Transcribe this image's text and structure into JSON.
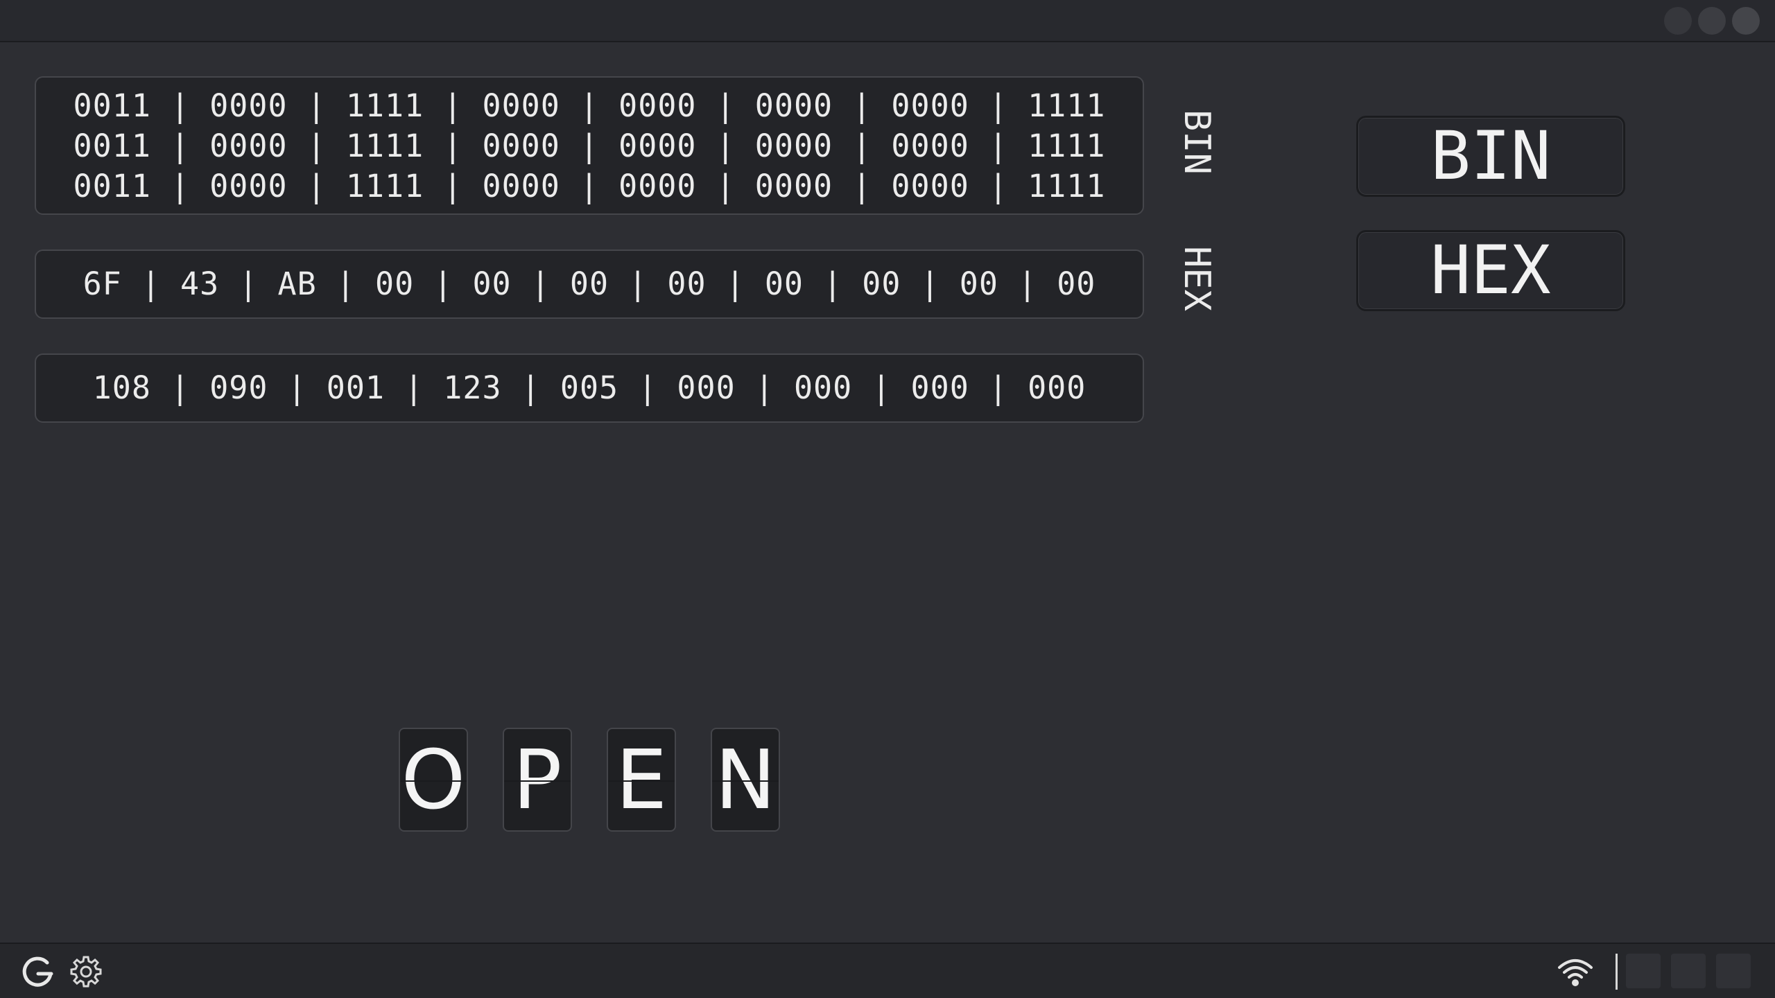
{
  "display": {
    "bin_rows": [
      "0011 | 0000 | 1111 | 0000 | 0000 | 0000 | 0000 | 1111",
      "0011 | 0000 | 1111 | 0000 | 0000 | 0000 | 0000 | 1111",
      "0011 | 0000 | 1111 | 0000 | 0000 | 0000 | 0000 | 1111"
    ],
    "bin_side_label": "BIN",
    "hex_row": "6F | 43 | AB | 00 | 00 | 00 | 00 | 00 | 00 | 00 | 00",
    "hex_side_label": "HEX",
    "dec_row": "108 | 090 | 001 | 123 | 005 | 000 | 000 | 000 | 000"
  },
  "mode_buttons": {
    "bin_label": "BIN",
    "hex_label": "HEX"
  },
  "flip_display": {
    "letters": [
      "O",
      "P",
      "E",
      "N"
    ]
  },
  "status_bar": {
    "left_icons": [
      "refresh-icon",
      "gear-icon"
    ],
    "right_icons": [
      "wifi-icon"
    ]
  },
  "colors": {
    "background": "#2d2e33",
    "panel": "#232428",
    "text": "#ececec",
    "bar": "#26272b"
  }
}
